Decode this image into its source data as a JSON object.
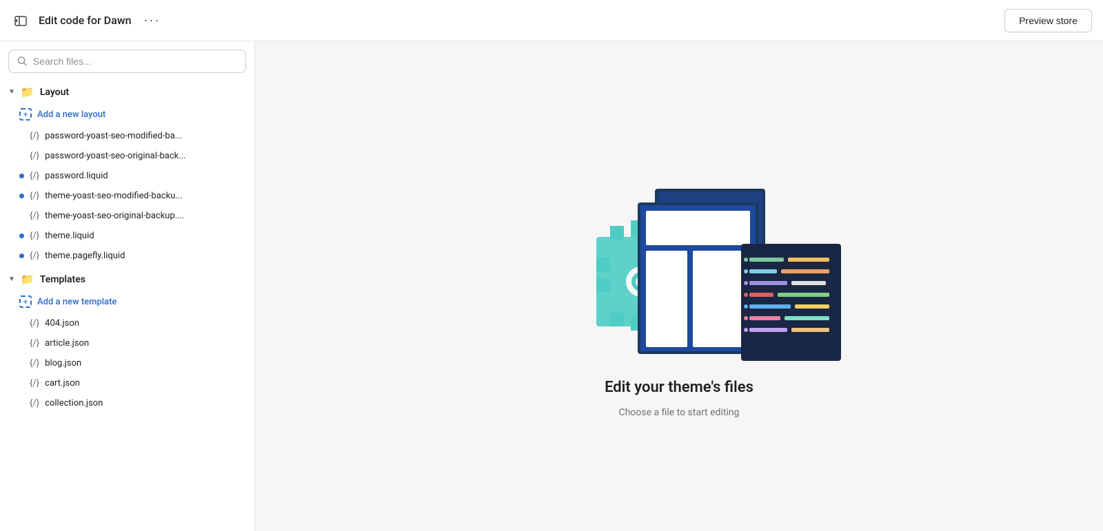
{
  "topbar": {
    "title": "Edit code for Dawn",
    "more_label": "···",
    "preview_label": "Preview store"
  },
  "search": {
    "placeholder": "Search files..."
  },
  "sidebar": {
    "sections": [
      {
        "id": "layout",
        "label": "Layout",
        "add_label": "Add a new layout",
        "files": [
          {
            "name": "password-yoast-seo-modified-ba...",
            "modified": false
          },
          {
            "name": "password-yoast-seo-original-back...",
            "modified": false
          },
          {
            "name": "password.liquid",
            "modified": true
          },
          {
            "name": "theme-yoast-seo-modified-backu...",
            "modified": true
          },
          {
            "name": "theme-yoast-seo-original-backup....",
            "modified": false
          },
          {
            "name": "theme.liquid",
            "modified": true
          },
          {
            "name": "theme.pagefly.liquid",
            "modified": true
          }
        ]
      },
      {
        "id": "templates",
        "label": "Templates",
        "add_label": "Add a new template",
        "files": [
          {
            "name": "404.json",
            "modified": false
          },
          {
            "name": "article.json",
            "modified": false
          },
          {
            "name": "blog.json",
            "modified": false
          },
          {
            "name": "cart.json",
            "modified": false
          },
          {
            "name": "collection.json",
            "modified": false
          }
        ]
      }
    ]
  },
  "welcome": {
    "title": "Edit your theme's files",
    "subtitle": "Choose a file to start editing"
  }
}
